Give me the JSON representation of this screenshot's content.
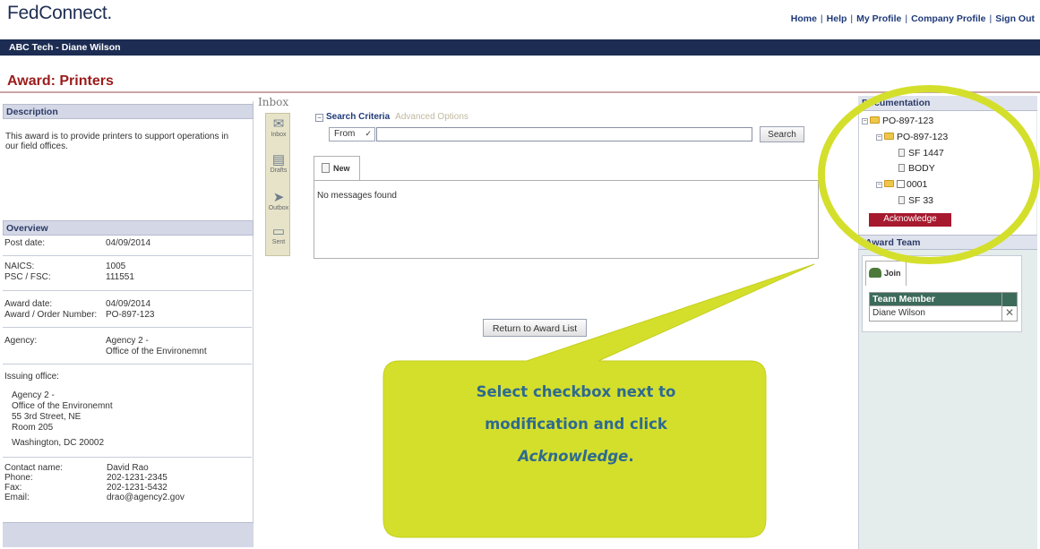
{
  "header": {
    "logo": "FedConnect.",
    "nav_links": [
      "Home",
      "Help",
      "My Profile",
      "Company Profile",
      "Sign Out"
    ],
    "user_bar": "ABC Tech - Diane Wilson"
  },
  "page": {
    "title": "Award: Printers"
  },
  "description": {
    "heading": "Description",
    "text": "This award is to provide printers to support operations in our field offices."
  },
  "overview": {
    "heading": "Overview",
    "post_date_label": "Post date:",
    "post_date": "04/09/2014",
    "naics_label": "NAICS:",
    "naics": "1005",
    "psc_label": "PSC / FSC:",
    "psc": "111551",
    "award_date_label": "Award date:",
    "award_date": "04/09/2014",
    "award_number_label": "Award / Order Number:",
    "award_number": "PO-897-123",
    "agency_label": "Agency:",
    "agency_line1": "Agency 2 -",
    "agency_line2": "Office of the Environemnt",
    "issuing_office_label": "Issuing office:",
    "issuing_lines": [
      "Agency 2 -",
      "Office of the Environemnt",
      "55 3rd Street, NE",
      "Room 205",
      "Washington, DC 20002"
    ],
    "contact_name_label": "Contact name:",
    "contact_name": "David Rao",
    "phone_label": "Phone:",
    "phone": "202-1231-2345",
    "fax_label": "Fax:",
    "fax": "202-1231-5432",
    "email_label": "Email:",
    "email": "drao@agency2.gov"
  },
  "inbox": {
    "label": "Inbox",
    "sidebar": [
      {
        "label": "Inbox",
        "icon": "inbox-icon"
      },
      {
        "label": "Drafts",
        "icon": "drafts-icon"
      },
      {
        "label": "Outbox",
        "icon": "outbox-icon"
      },
      {
        "label": "Sent",
        "icon": "sent-icon"
      }
    ],
    "search_criteria_label": "Search Criteria",
    "advanced_options_label": "Advanced Options",
    "from_select": "From",
    "search_value": "",
    "search_button": "Search",
    "tab_new": "New",
    "empty_message": "No messages found"
  },
  "return_button": "Return to Award List",
  "documentation": {
    "heading": "Documentation",
    "tree": {
      "root": "PO-897-123",
      "child": "PO-897-123",
      "files": [
        "SF 1447",
        "BODY"
      ],
      "modification": "0001",
      "mod_files": [
        "SF 33"
      ]
    },
    "acknowledge_button": "Acknowledge"
  },
  "award_team": {
    "heading": "Award Team",
    "join_label": "Join",
    "column_header": "Team Member",
    "members": [
      "Diane Wilson"
    ]
  },
  "callout": {
    "line1": "Select checkbox next to",
    "line2": "modification and click",
    "line3": "Acknowledge",
    "line3_suffix": ".",
    "fill_color": "#d4df2c",
    "text_color": "#2e6a8f"
  },
  "colors": {
    "header_bar": "#1c2c52",
    "title_red": "#9b1c1c",
    "acknowledge_red": "#a6192e",
    "highlight_ring": "#d4df2c"
  }
}
